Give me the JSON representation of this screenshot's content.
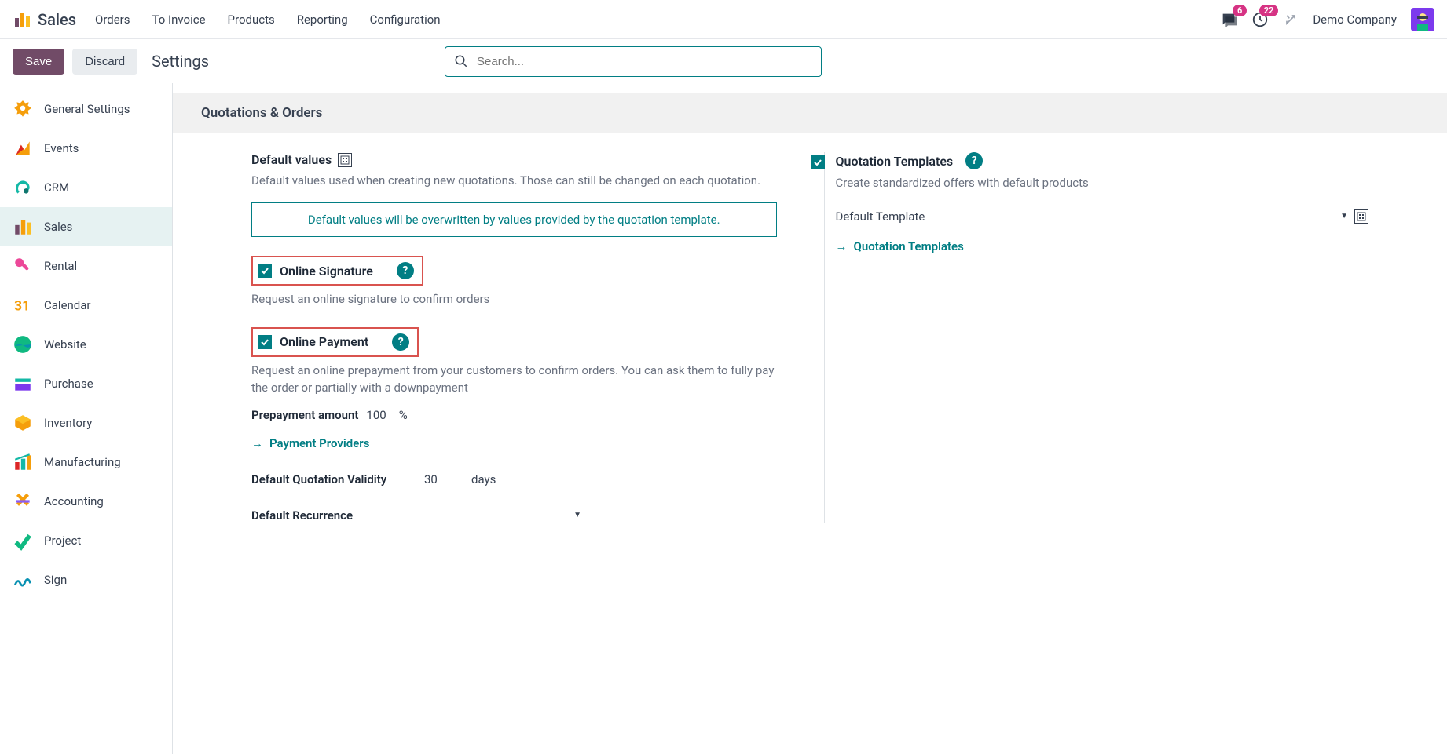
{
  "topbar": {
    "app_title": "Sales",
    "menu": [
      "Orders",
      "To Invoice",
      "Products",
      "Reporting",
      "Configuration"
    ],
    "chat_badge": "6",
    "activity_badge": "22",
    "company": "Demo Company"
  },
  "toolbar": {
    "save": "Save",
    "discard": "Discard",
    "page_title": "Settings",
    "search_placeholder": "Search..."
  },
  "sidebar": [
    {
      "label": "General Settings",
      "icon": "gear"
    },
    {
      "label": "Events",
      "icon": "events"
    },
    {
      "label": "CRM",
      "icon": "crm"
    },
    {
      "label": "Sales",
      "icon": "sales",
      "active": true
    },
    {
      "label": "Rental",
      "icon": "rental"
    },
    {
      "label": "Calendar",
      "icon": "calendar"
    },
    {
      "label": "Website",
      "icon": "website"
    },
    {
      "label": "Purchase",
      "icon": "purchase"
    },
    {
      "label": "Inventory",
      "icon": "inventory"
    },
    {
      "label": "Manufacturing",
      "icon": "manufacturing"
    },
    {
      "label": "Accounting",
      "icon": "accounting"
    },
    {
      "label": "Project",
      "icon": "project"
    },
    {
      "label": "Sign",
      "icon": "sign"
    }
  ],
  "section": {
    "header": "Quotations & Orders",
    "left": {
      "default_values": {
        "title": "Default values",
        "desc": "Default values used when creating new quotations. Those can still be changed on each quotation.",
        "info": "Default values will be overwritten by values provided by the quotation template."
      },
      "online_signature": {
        "title": "Online Signature",
        "checked": true,
        "desc": "Request an online signature to confirm orders"
      },
      "online_payment": {
        "title": "Online Payment",
        "checked": true,
        "desc": "Request an online prepayment from your customers to confirm orders. You can ask them to fully pay the order or partially with a downpayment",
        "prepay_label": "Prepayment amount",
        "prepay_value": "100",
        "prepay_unit": "%",
        "providers_link": "Payment Providers"
      },
      "validity": {
        "label": "Default Quotation Validity",
        "value": "30",
        "unit": "days"
      },
      "recurrence": {
        "label": "Default Recurrence",
        "value": ""
      }
    },
    "right": {
      "quotation_templates": {
        "title": "Quotation Templates",
        "checked": true,
        "desc": "Create standardized offers with default products",
        "default_template_label": "Default Template",
        "link": "Quotation Templates"
      }
    }
  }
}
